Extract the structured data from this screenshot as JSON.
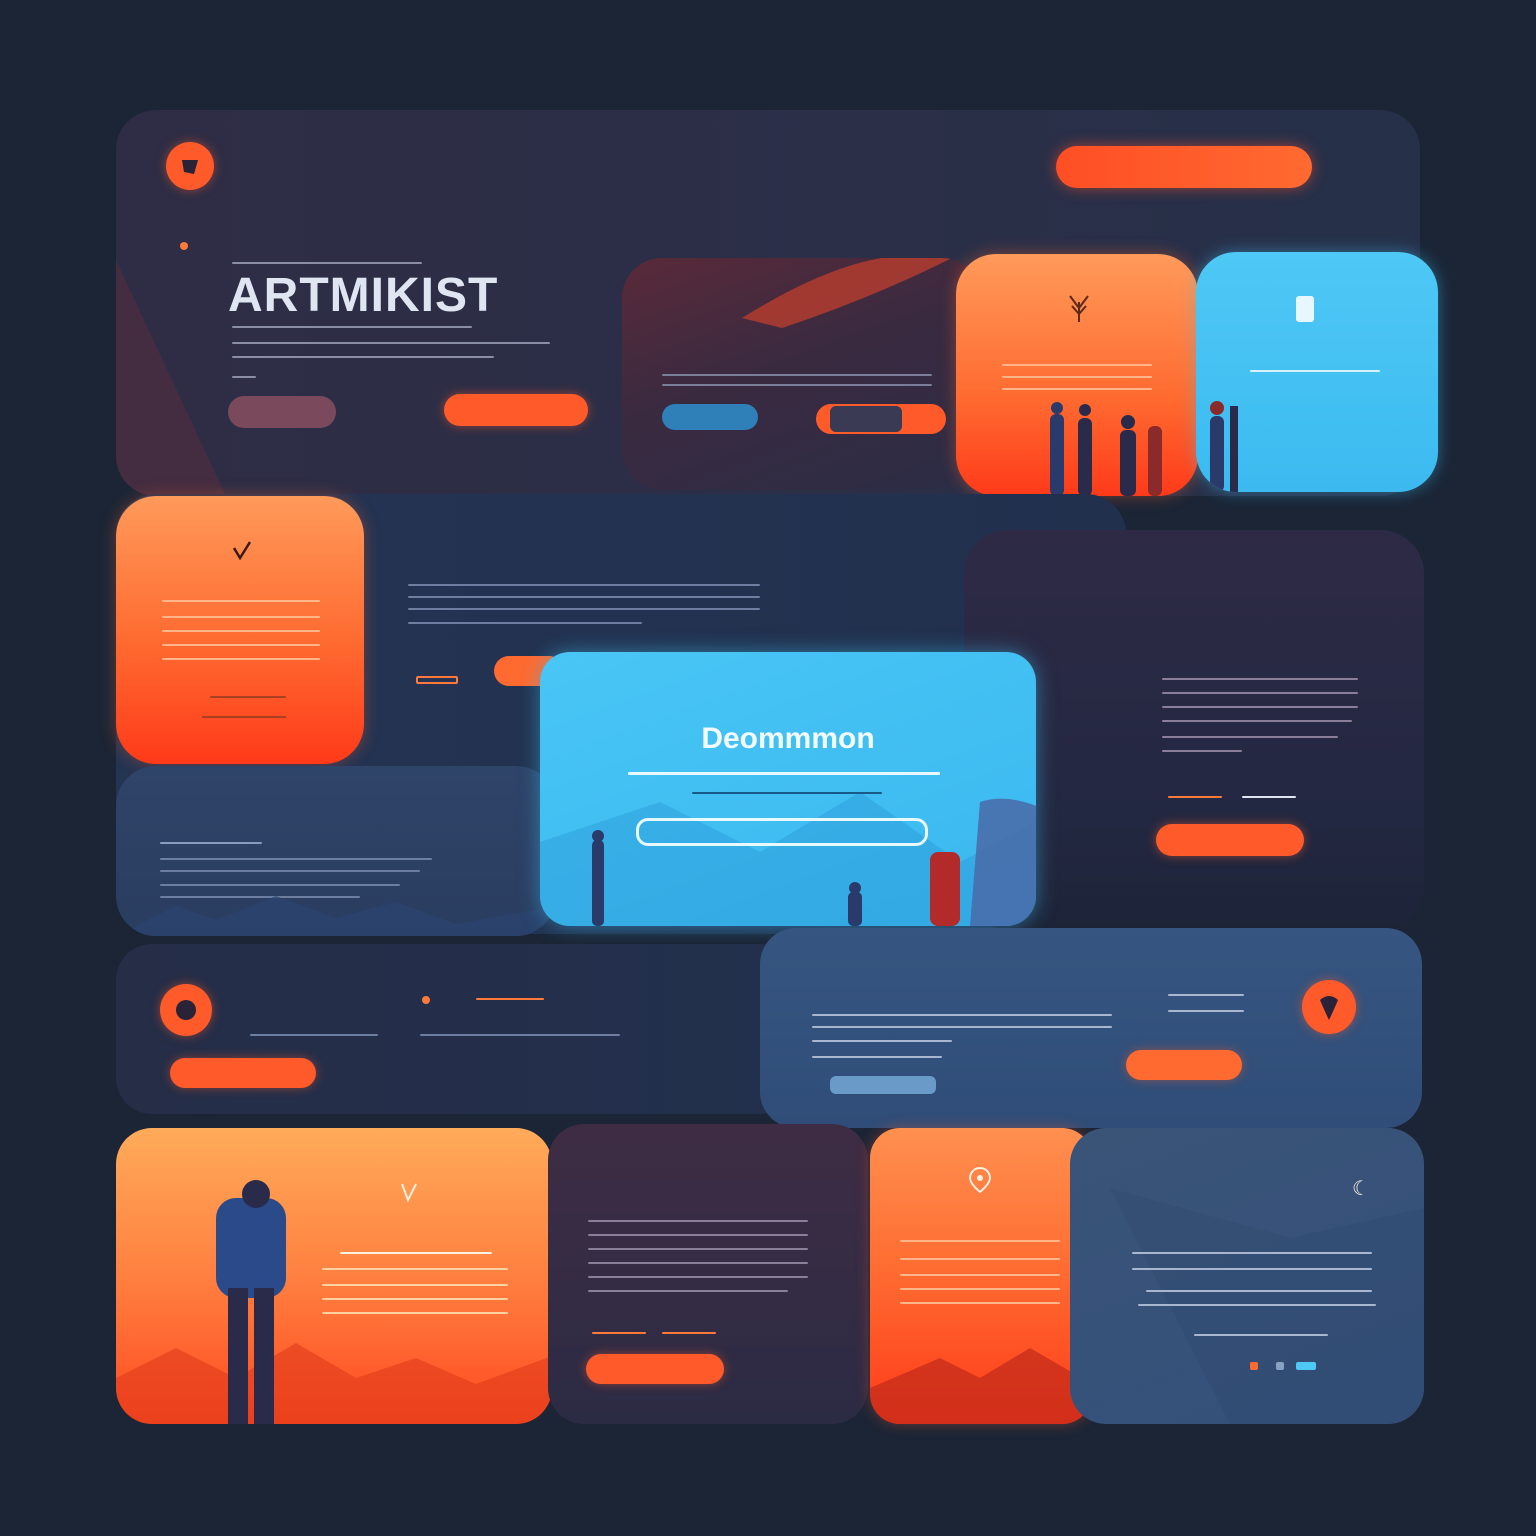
{
  "nav": {
    "items": [
      "",
      "",
      "",
      "",
      "",
      ""
    ],
    "cta_label": "",
    "end_label": ""
  },
  "hero": {
    "title": "ARTMIKIST",
    "secondary_button": "",
    "primary_button": ""
  },
  "cards": {
    "hero_card_1_title": "",
    "hero_card_2_title": "",
    "hero_card_3_title": "",
    "mid_left_title": "",
    "mid_text_title": "",
    "blue_card_title": "Deommmon",
    "right_card_title": "",
    "right_card_button": "",
    "left_lower_title": "",
    "row3_left_label": "",
    "row3_left_button": "",
    "row3_right_title": "",
    "row3_right_button": "",
    "bottom_card1_title": "",
    "bottom_card2_title": "",
    "bottom_card2_button": "",
    "bottom_card3_title": "",
    "bottom_card4_title": ""
  },
  "colors": {
    "background": "#1b2536",
    "accent_orange": "#ff5a2a",
    "accent_blue": "#3fc0f2",
    "panel_dark": "#2a2f45"
  }
}
